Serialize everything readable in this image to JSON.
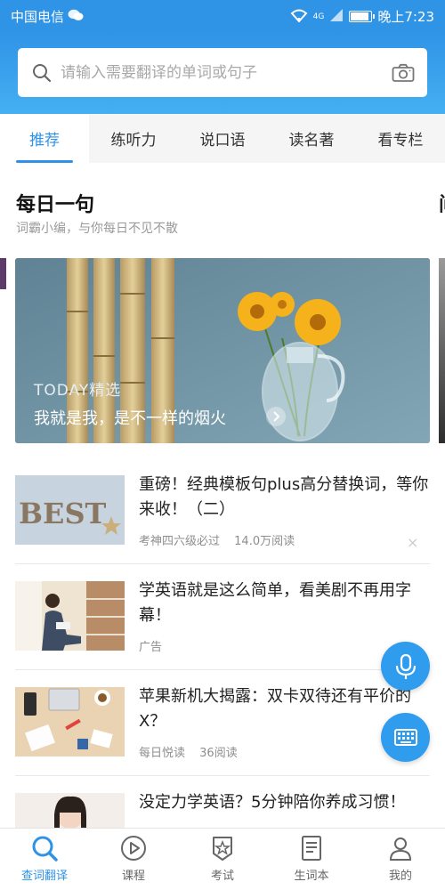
{
  "status_bar": {
    "carrier": "中国电信",
    "network_label": "4G",
    "time": "晚上7:23"
  },
  "search": {
    "placeholder": "请输入需要翻译的单词或句子"
  },
  "tabs": [
    {
      "label": "推荐",
      "active": true
    },
    {
      "label": "练听力",
      "active": false
    },
    {
      "label": "说口语",
      "active": false
    },
    {
      "label": "读名著",
      "active": false
    },
    {
      "label": "看专栏",
      "active": false
    }
  ],
  "daily": {
    "title": "每日一句",
    "subtitle": "词霸小编，与你每日不见不散",
    "next_card_title_peek": "间",
    "banner_tag": "TODAY精选",
    "banner_quote": "我就是我，是不一样的烟火"
  },
  "articles": [
    {
      "title": "重磅！经典模板句plus高分替换词，等你来收！（二）",
      "source": "考神四六级必过",
      "reads": "14.0万阅读",
      "thumb_text": "BEST"
    },
    {
      "title": "学英语就是这么简单，看美剧不再用字幕！",
      "source": "广告",
      "reads": ""
    },
    {
      "title": "苹果新机大揭露：双卡双待还有平价的X？",
      "source": "每日悦读",
      "reads": "36阅读"
    },
    {
      "title": "没定力学英语？5分钟陪你养成习惯！",
      "source": "",
      "reads": ""
    }
  ],
  "close_symbol": "×",
  "bottom_nav": [
    {
      "label": "查词翻译",
      "icon": "search-icon",
      "active": true
    },
    {
      "label": "课程",
      "icon": "play-circle-icon",
      "active": false
    },
    {
      "label": "考试",
      "icon": "badge-star-icon",
      "active": false
    },
    {
      "label": "生词本",
      "icon": "notebook-icon",
      "active": false
    },
    {
      "label": "我的",
      "icon": "person-icon",
      "active": false
    }
  ],
  "colors": {
    "brand_blue": "#2e93e6",
    "header_gradient_end": "#44b0f2",
    "fab_blue": "#2f9cee"
  }
}
